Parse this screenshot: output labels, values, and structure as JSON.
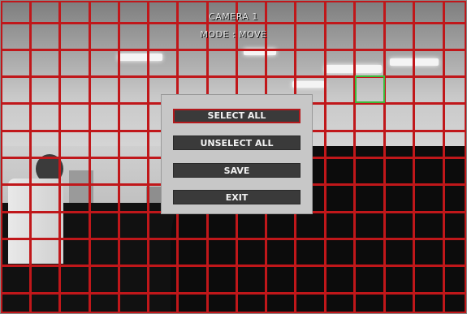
{
  "osd": {
    "camera_label": "CAMERA 1",
    "mode_label": "MODE : MOVE"
  },
  "menu": {
    "items": [
      {
        "label": "SELECT ALL",
        "selected": true
      },
      {
        "label": "UNSELECT ALL",
        "selected": false
      },
      {
        "label": "SAVE",
        "selected": false
      },
      {
        "label": "EXIT",
        "selected": false
      }
    ]
  },
  "colors": {
    "grid": "#c0171a",
    "selected_cell": "#3cba3c",
    "menu_background": "#c7c7c7",
    "button": "#3a3a3a",
    "focus_border": "#b3191c"
  }
}
